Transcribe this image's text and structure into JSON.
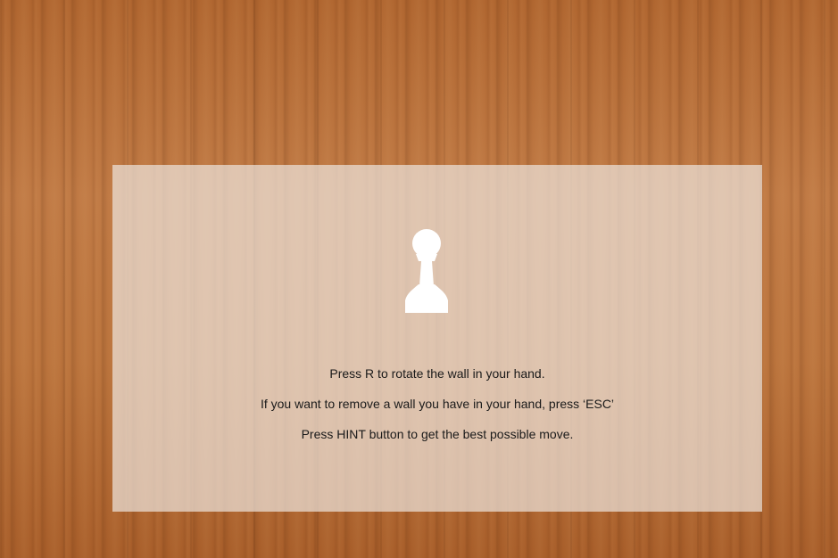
{
  "help_overlay": {
    "icon": "pawn-icon",
    "instructions": [
      "Press R to rotate the wall in your hand.",
      "If you want to remove a wall you have in your hand, press ‘ESC’",
      "Press HINT button to get the best possible move."
    ]
  },
  "colors": {
    "wood": "#b8713a",
    "panel": "#ece2da",
    "pawn": "#ffffff",
    "text": "#1a1a1a"
  }
}
